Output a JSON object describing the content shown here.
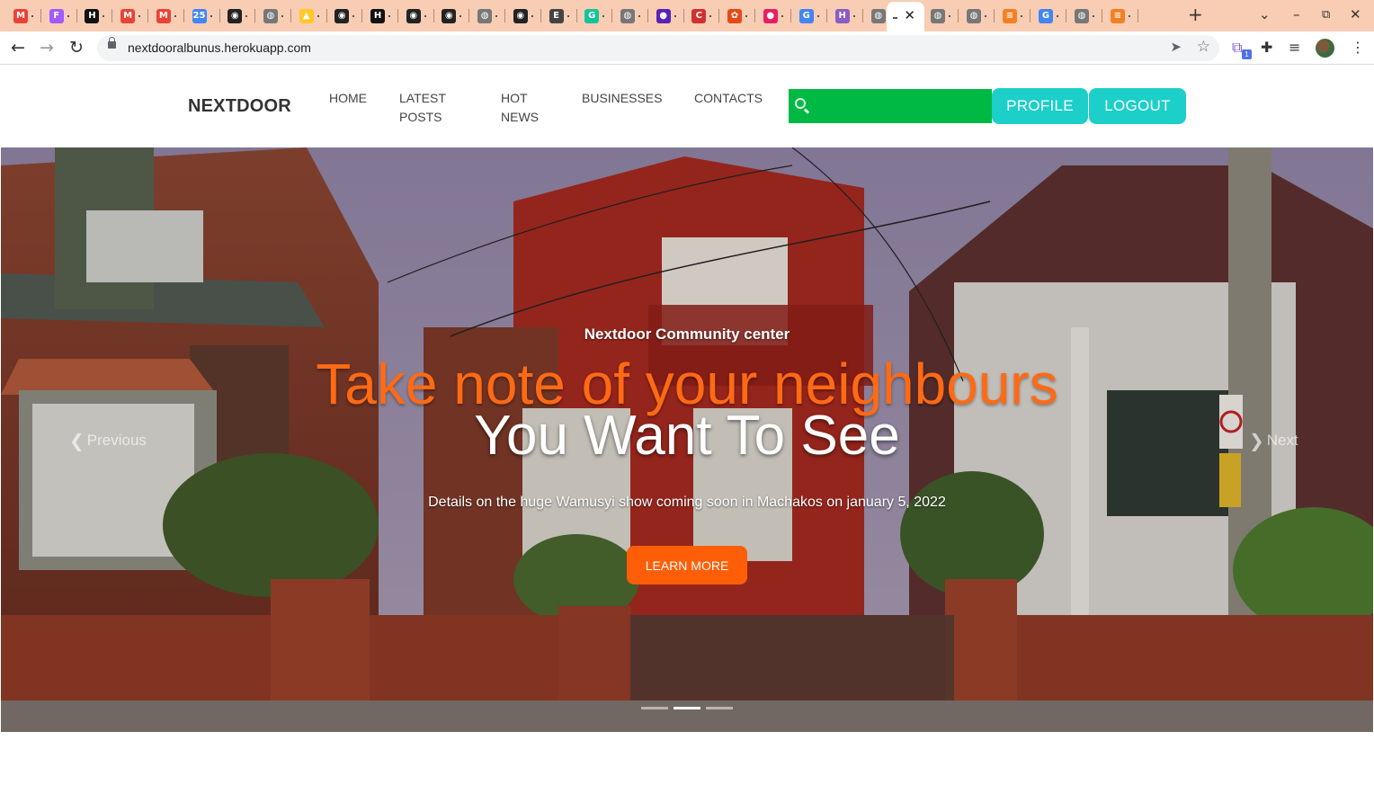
{
  "browser": {
    "url": "nextdooralbunus.herokuapp.com",
    "tabs": [
      {
        "icon": "gmail-icon",
        "color": "#ea4335",
        "glyph": "M"
      },
      {
        "icon": "figma-icon",
        "color": "#a259ff",
        "glyph": "F"
      },
      {
        "icon": "hashnode-icon",
        "color": "#111111",
        "glyph": "H"
      },
      {
        "icon": "gmail-icon",
        "color": "#ea4335",
        "glyph": "M"
      },
      {
        "icon": "gmail-icon",
        "color": "#ea4335",
        "glyph": "M"
      },
      {
        "icon": "calendar-icon",
        "color": "#4285f4",
        "glyph": "25"
      },
      {
        "icon": "github-icon",
        "color": "#222222",
        "glyph": "◉"
      },
      {
        "icon": "globe-icon",
        "color": "#777777",
        "glyph": "◍"
      },
      {
        "icon": "firebase-icon",
        "color": "#ffca28",
        "glyph": "▲"
      },
      {
        "icon": "github-icon",
        "color": "#222222",
        "glyph": "◉"
      },
      {
        "icon": "hashnode-icon",
        "color": "#111111",
        "glyph": "H"
      },
      {
        "icon": "github-icon",
        "color": "#222222",
        "glyph": "◉"
      },
      {
        "icon": "github-icon",
        "color": "#222222",
        "glyph": "◉"
      },
      {
        "icon": "globe-icon",
        "color": "#777777",
        "glyph": "◍"
      },
      {
        "icon": "github-icon",
        "color": "#222222",
        "glyph": "◉"
      },
      {
        "icon": "audio-tab-icon",
        "color": "#444444",
        "glyph": "E"
      },
      {
        "icon": "grammarly-icon",
        "color": "#15c39a",
        "glyph": "G"
      },
      {
        "icon": "globe-icon",
        "color": "#777777",
        "glyph": "◍"
      },
      {
        "icon": "circle-app-icon",
        "color": "#5b21b6",
        "glyph": "●"
      },
      {
        "icon": "c-app-icon",
        "color": "#d32f2f",
        "glyph": "C"
      },
      {
        "icon": "color-wheel-icon",
        "color": "#e64a19",
        "glyph": "✿"
      },
      {
        "icon": "pink-dot-icon",
        "color": "#e91e63",
        "glyph": "●"
      },
      {
        "icon": "google-icon",
        "color": "#4285f4",
        "glyph": "G"
      },
      {
        "icon": "heroku-icon",
        "color": "#8a5cc7",
        "glyph": "H"
      },
      {
        "icon": "globe-icon",
        "color": "#777777",
        "glyph": "◍"
      },
      {
        "icon": "globe-icon",
        "color": "#777777",
        "glyph": "◍"
      },
      {
        "icon": "globe-icon",
        "color": "#777777",
        "glyph": "◍"
      },
      {
        "icon": "stackoverflow-icon",
        "color": "#f48024",
        "glyph": "≡"
      },
      {
        "icon": "google-icon",
        "color": "#4285f4",
        "glyph": "G"
      },
      {
        "icon": "globe-icon",
        "color": "#777777",
        "glyph": "◍"
      },
      {
        "icon": "stackoverflow-icon",
        "color": "#f48024",
        "glyph": "≡"
      }
    ],
    "new_tab_glyph": "+",
    "extension_badge": "1"
  },
  "site": {
    "brand": "NEXTDOOR",
    "nav": {
      "home": "HOME",
      "latest_posts_line1": "LATEST",
      "latest_posts_line2": "POSTS",
      "hot_news_line1": "HOT",
      "hot_news_line2": "NEWS",
      "businesses": "BUSINESSES",
      "contacts": "CONTACTS"
    },
    "search": {
      "placeholder": "",
      "value": ""
    },
    "profile_label": "PROFILE",
    "logout_label": "LOGOUT",
    "colors": {
      "search_bg": "#00b944",
      "pill_bg": "#1ccfc9",
      "accent_orange": "#ff6a14",
      "cta_orange": "#ff5e08"
    }
  },
  "hero": {
    "eyebrow": "Nextdoor Community center",
    "headline_orange": "Take note of your neighbours",
    "headline_white": "You Want To See",
    "subtitle": "Details on the huge Wamusyi show coming soon in Machakos on january 5, 2022",
    "cta_label": "LEARN MORE",
    "prev_label": "Previous",
    "next_label": "Next",
    "slides": 3,
    "active_slide": 2
  }
}
